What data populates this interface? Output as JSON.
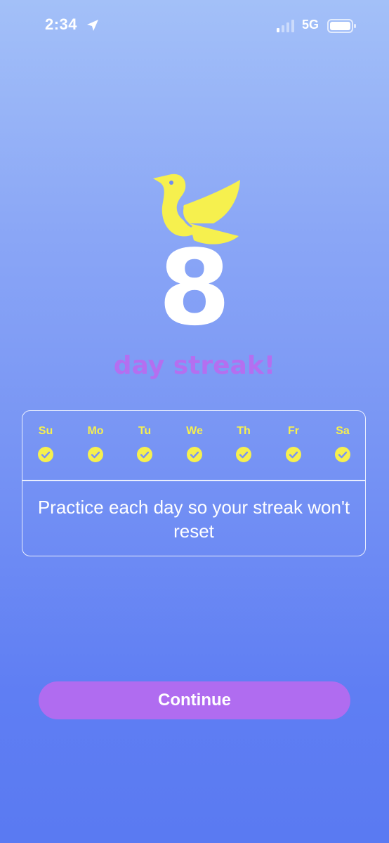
{
  "status_bar": {
    "time": "2:34",
    "network": "5G",
    "icons": [
      "location-arrow-icon",
      "signal-icon",
      "battery-icon"
    ]
  },
  "streak": {
    "count": "8",
    "label": "day streak!",
    "logo": "bird-logo"
  },
  "week": {
    "days": [
      {
        "label": "Su",
        "completed": true
      },
      {
        "label": "Mo",
        "completed": true
      },
      {
        "label": "Tu",
        "completed": true
      },
      {
        "label": "We",
        "completed": true
      },
      {
        "label": "Th",
        "completed": true
      },
      {
        "label": "Fr",
        "completed": true
      },
      {
        "label": "Sa",
        "completed": true
      }
    ],
    "message": "Practice each day so your streak won't reset"
  },
  "continue_label": "Continue",
  "colors": {
    "accent_purple": "#b06cf0",
    "accent_yellow": "#f6f04e",
    "background_top": "#a3c0f8",
    "background_bottom": "#5a7af2"
  }
}
